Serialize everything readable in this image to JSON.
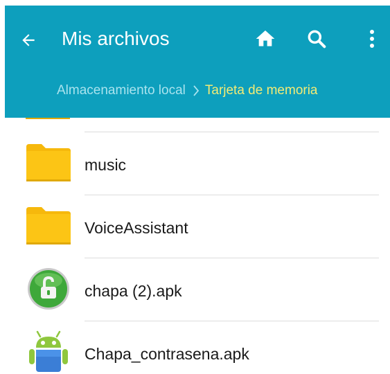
{
  "appbar": {
    "title": "Mis archivos",
    "back_icon": "arrow-left-icon",
    "actions": [
      "home-icon",
      "search-icon",
      "more-vert-icon"
    ],
    "color": "#0d9fbd"
  },
  "breadcrumb": {
    "parent": "Almacenamiento local",
    "separator_icon": "chevron-right-icon",
    "current": "Tarjeta de memoria",
    "current_color": "#f3eb75"
  },
  "files": [
    {
      "name": "music",
      "icon": "folder-icon"
    },
    {
      "name": "VoiceAssistant",
      "icon": "folder-icon"
    },
    {
      "name": "chapa (2).apk",
      "icon": "green-lock-app-icon"
    },
    {
      "name": "Chapa_contrasena.apk",
      "icon": "android-app-icon"
    }
  ],
  "colors": {
    "folder": "#fcc515",
    "folder_tab": "#f6b80c",
    "divider": "#dcdcdc"
  }
}
